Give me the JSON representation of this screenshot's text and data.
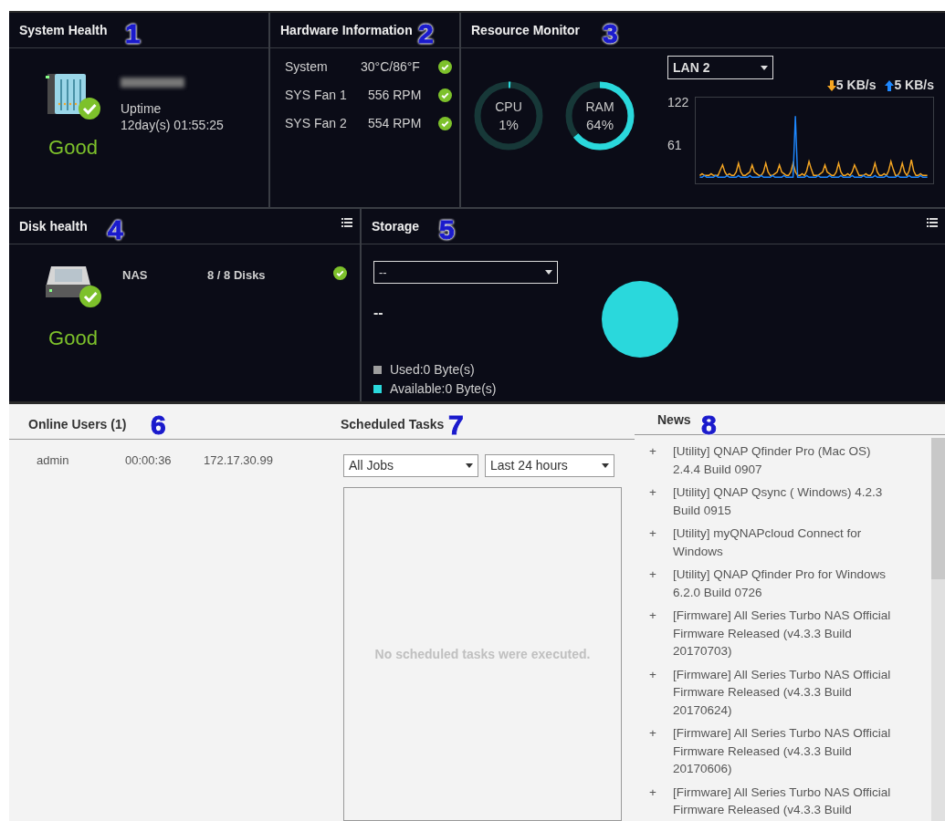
{
  "system_health": {
    "title": "System Health",
    "callout": "1",
    "uptime_label": "Uptime",
    "uptime": "12day(s) 01:55:25",
    "status": "Good"
  },
  "hardware_information": {
    "title": "Hardware Information",
    "callout": "2",
    "rows": [
      {
        "label": "System",
        "value": "30°C/86°F",
        "ok": true
      },
      {
        "label": "SYS Fan 1",
        "value": "556 RPM",
        "ok": true
      },
      {
        "label": "SYS Fan 2",
        "value": "554 RPM",
        "ok": true
      }
    ]
  },
  "resource_monitor": {
    "title": "Resource Monitor",
    "callout": "3",
    "gauges": [
      {
        "label": "CPU",
        "reading": "1%",
        "level": 0.01
      },
      {
        "label": "RAM",
        "reading": "64%",
        "level": 0.64
      }
    ],
    "interface": "LAN 2",
    "download": "5 KB/s",
    "upload": "5 KB/s",
    "y_ticks": [
      "122",
      "61"
    ]
  },
  "disk_health": {
    "title": "Disk health",
    "callout": "4",
    "rows": [
      {
        "name": "NAS",
        "disks": "8 / 8 Disks",
        "ok": true
      }
    ],
    "status": "Good"
  },
  "storage": {
    "title": "Storage",
    "callout": "5",
    "volume": "--",
    "volume_name": "--",
    "legend": [
      {
        "label": "Used:0 Byte(s)",
        "color": "#9e9e9e"
      },
      {
        "label": "Available:0 Byte(s)",
        "color": "#2ad8dc"
      }
    ]
  },
  "online_users": {
    "title": "Online Users (1)",
    "callout": "6",
    "rows": [
      {
        "user": "admin",
        "duration": "00:00:36",
        "ip": "172.17.30.99"
      }
    ]
  },
  "scheduled_tasks": {
    "title": "Scheduled Tasks",
    "callout": "7",
    "filter": "All Jobs",
    "period": "Last 24 hours",
    "empty_message": "No scheduled tasks were executed."
  },
  "news": {
    "title": "News",
    "callout": "8",
    "items": [
      {
        "bullet": "+",
        "text": "[Utility] QNAP Qfinder Pro (Mac OS) 2.4.4 Build 0907"
      },
      {
        "bullet": "+",
        "text": "[Utility] QNAP Qsync ( Windows) 4.2.3 Build 0915"
      },
      {
        "bullet": "+",
        "text": "[Utility] myQNAPcloud Connect for Windows"
      },
      {
        "bullet": "+",
        "text": "[Utility] QNAP Qfinder Pro for Windows 6.2.0 Build 0726"
      },
      {
        "bullet": "+",
        "text": "[Firmware] All Series Turbo NAS Official Firmware Released (v4.3.3 Build 20170703)"
      },
      {
        "bullet": "+",
        "text": "[Firmware] All Series Turbo NAS Official Firmware Released (v4.3.3 Build 20170624)"
      },
      {
        "bullet": "+",
        "text": "[Firmware] All Series Turbo NAS Official Firmware Released (v4.3.3 Build 20170606)"
      },
      {
        "bullet": "+",
        "text": "[Firmware] All Series Turbo NAS Official Firmware Released (v4.3.3 Build"
      }
    ]
  }
}
